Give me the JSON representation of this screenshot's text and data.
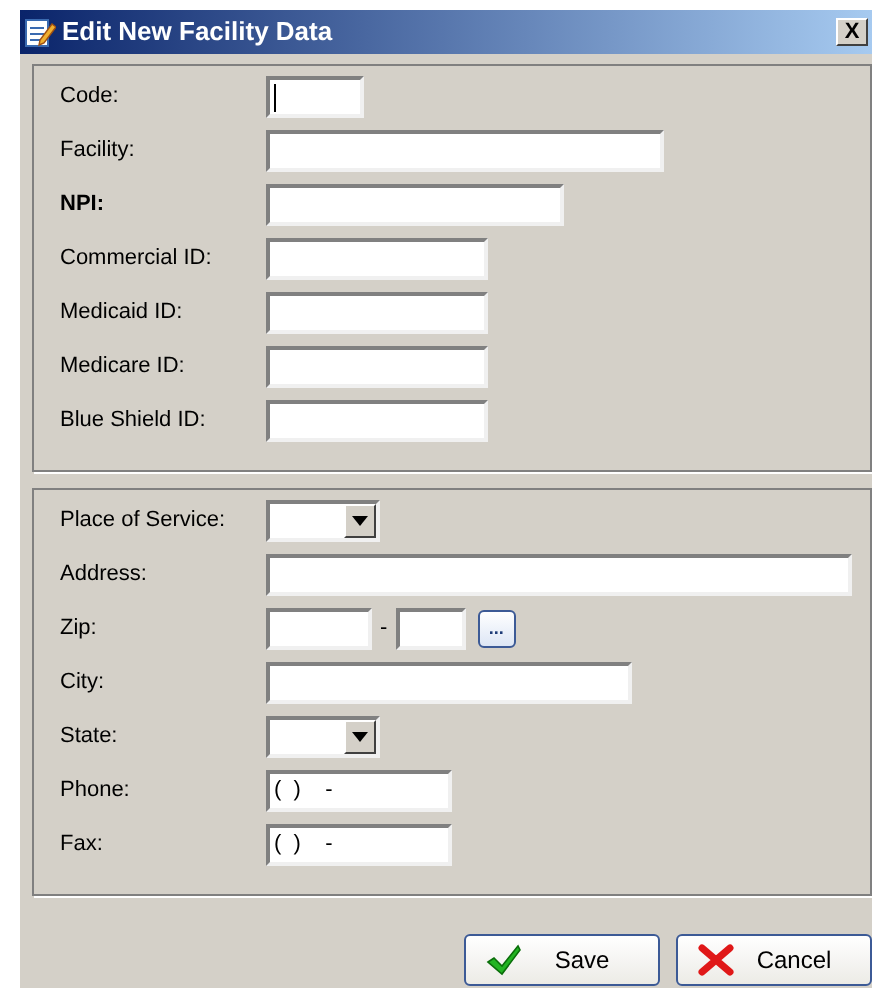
{
  "window": {
    "title": "Edit New Facility Data",
    "close": "X"
  },
  "groups": [
    {
      "fields": [
        {
          "label": "Code:",
          "bold": false,
          "kind": "text",
          "focused": true
        },
        {
          "label": "Facility:",
          "bold": false,
          "kind": "text",
          "focused": false
        },
        {
          "label": "NPI:",
          "bold": true,
          "kind": "text",
          "focused": false
        },
        {
          "label": "Commercial ID:",
          "bold": false,
          "kind": "text",
          "focused": false
        },
        {
          "label": "Medicaid ID:",
          "bold": false,
          "kind": "text",
          "focused": false
        },
        {
          "label": "Medicare ID:",
          "bold": false,
          "kind": "text",
          "focused": false
        },
        {
          "label": "Blue Shield ID:",
          "bold": false,
          "kind": "text",
          "focused": false
        }
      ]
    },
    {
      "fields": [
        {
          "label": "Place of Service:",
          "bold": false,
          "kind": "combo",
          "focused": false
        },
        {
          "label": "Address:",
          "bold": false,
          "kind": "text",
          "focused": false
        },
        {
          "label": "Zip:",
          "bold": false,
          "kind": "zip",
          "separator": "-",
          "button": "...",
          "focused": false
        },
        {
          "label": "City:",
          "bold": false,
          "kind": "text",
          "focused": false
        },
        {
          "label": "State:",
          "bold": false,
          "kind": "combo",
          "focused": false
        },
        {
          "label": "Phone:",
          "bold": false,
          "kind": "text",
          "value": "(  )    -",
          "focused": false
        },
        {
          "label": "Fax:",
          "bold": false,
          "kind": "text",
          "value": "(  )    -",
          "focused": false
        }
      ]
    }
  ],
  "buttons": [
    {
      "kind": "save",
      "label": "Save"
    },
    {
      "kind": "cancel",
      "label": "Cancel"
    }
  ]
}
